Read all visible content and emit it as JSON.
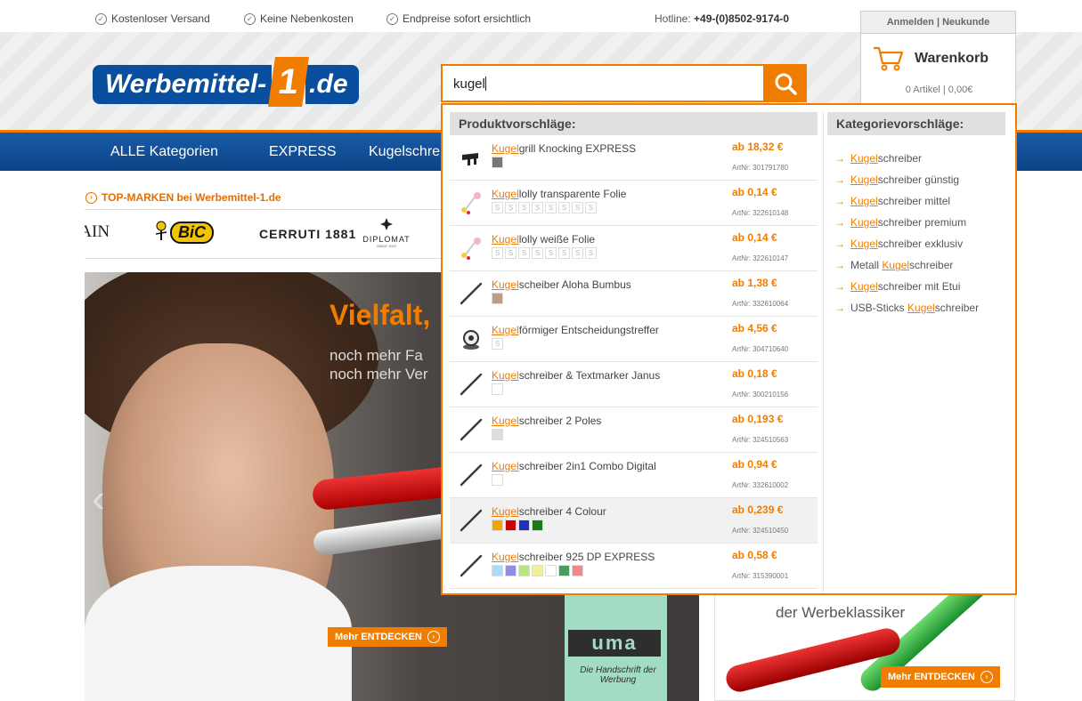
{
  "topbar": {
    "usps": [
      "Kostenloser Versand",
      "Keine Nebenkosten",
      "Endpreise sofort ersichtlich"
    ],
    "hotline_label": "Hotline:",
    "hotline_number": "+49-(0)8502-9174-0"
  },
  "logo": {
    "part1": "Werbemittel-",
    "part2": "1",
    "part3": ".de"
  },
  "search": {
    "value": "kugel"
  },
  "account": {
    "links": "Anmelden | Neukunde",
    "cart_title": "Warenkorb",
    "cart_info": "0 Artikel | 0,00€"
  },
  "nav": {
    "items": [
      "ALLE Kategorien",
      "EXPRESS",
      "Kugelschre"
    ]
  },
  "brands": {
    "title": "TOP-MARKEN bei Werbemittel-1.de",
    "items": [
      "IAIN",
      "BiC",
      "CERRUTI 1881",
      "DIPLOMAT"
    ],
    "sub_items": [
      "IS",
      "SINCE 1922"
    ]
  },
  "hero": {
    "title": "Vielfalt,",
    "line1": "noch mehr Fa",
    "line2": "noch mehr Ver",
    "button": "Mehr ENTDECKEN"
  },
  "uma": {
    "logo": "uma",
    "tagline": "Die Handschrift der Werbung"
  },
  "right_promo": {
    "subtitle": "der Werbeklassiker",
    "button": "Mehr ENTDECKEN"
  },
  "suggestions": {
    "products_heading": "Produktvorschläge:",
    "categories_heading": "Kategorievorschläge:",
    "match": "Kugel",
    "products": [
      {
        "rest": "grill Knocking EXPRESS",
        "price": "ab 18,32 €",
        "art": "ArtNr: 301791780",
        "swatches": [
          "#777777"
        ],
        "icon": "grill-icon"
      },
      {
        "rest": "lolly transparente Folie",
        "price": "ab 0,14 €",
        "art": "ArtNr: 322610148",
        "swatches": [
          "s",
          "s",
          "s",
          "s",
          "s",
          "s",
          "s",
          "s"
        ],
        "icon": "lolly-icon"
      },
      {
        "rest": "lolly weiße Folie",
        "price": "ab 0,14 €",
        "art": "ArtNr: 322610147",
        "swatches": [
          "s",
          "s",
          "s",
          "s",
          "s",
          "s",
          "s",
          "s"
        ],
        "icon": "lolly-icon"
      },
      {
        "rest": "scheiber Aloha Bumbus",
        "price": "ab 1,38 €",
        "art": "ArtNr: 332610064",
        "swatches": [
          "#c19a8a"
        ],
        "icon": "pen-icon"
      },
      {
        "rest": "förmiger Entscheidungstreffer",
        "price": "ab 4,56 €",
        "art": "ArtNr: 304710640",
        "swatches": [
          "s"
        ],
        "icon": "ball-icon"
      },
      {
        "rest": "schreiber & Textmarker Janus",
        "price": "ab 0,18 €",
        "art": "ArtNr: 300210156",
        "swatches": [
          "#ffffff"
        ],
        "icon": "pen-icon"
      },
      {
        "rest": "schreiber 2 Poles",
        "price": "ab 0,193 €",
        "art": "ArtNr: 324510563",
        "swatches": [
          "#dddddd"
        ],
        "icon": "pen-icon"
      },
      {
        "rest": "schreiber 2in1 Combo Digital",
        "price": "ab 0,94 €",
        "art": "ArtNr: 332610002",
        "swatches": [
          "#ffffff"
        ],
        "icon": "pen-icon"
      },
      {
        "rest": "schreiber 4 Colour",
        "price": "ab 0,239 €",
        "art": "ArtNr: 324510450",
        "swatches": [
          "#f5a300",
          "#d10000",
          "#1f2fbf",
          "#1a7a1a"
        ],
        "icon": "pen-icon"
      },
      {
        "rest": "schreiber 925 DP EXPRESS",
        "price": "ab 0,58 €",
        "art": "ArtNr: 315390001",
        "swatches": [
          "#a9dcf5",
          "#8f8fe0",
          "#b7e67a",
          "#f0f09a",
          "#ffffff",
          "#4c9a5f",
          "#f08a8a"
        ],
        "icon": "pen-icon"
      }
    ],
    "categories": [
      {
        "pre": "",
        "match": "Kugel",
        "post": "schreiber"
      },
      {
        "pre": "",
        "match": "Kugel",
        "post": "schreiber günstig"
      },
      {
        "pre": "",
        "match": "Kugel",
        "post": "schreiber mittel"
      },
      {
        "pre": "",
        "match": "Kugel",
        "post": "schreiber premium"
      },
      {
        "pre": "",
        "match": "Kugel",
        "post": "schreiber exklusiv"
      },
      {
        "pre": "Metall ",
        "match": "Kugel",
        "post": "schreiber"
      },
      {
        "pre": "",
        "match": "Kugel",
        "post": "schreiber mit Etui"
      },
      {
        "pre": "USB-Sticks ",
        "match": "Kugel",
        "post": "schreiber"
      }
    ]
  },
  "colors": {
    "accent": "#f07d00",
    "brand_blue": "#0a4f9e"
  }
}
